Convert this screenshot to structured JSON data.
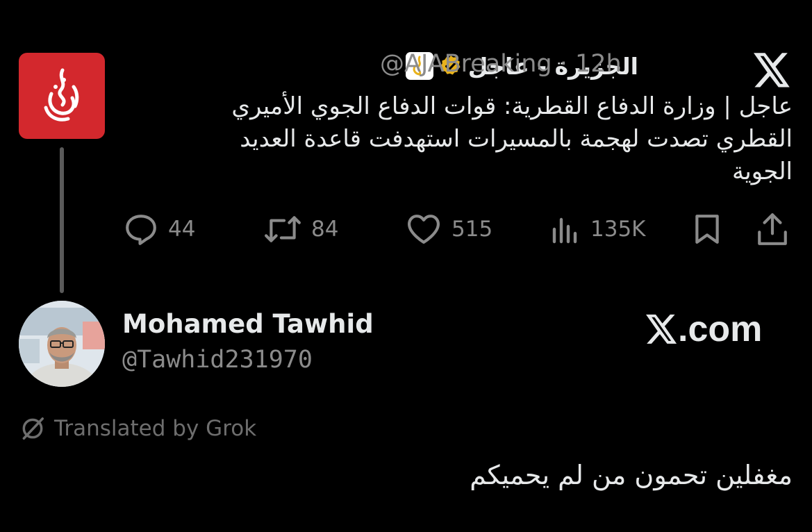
{
  "quoted_tweet": {
    "display_name": "الجزيرة - عاجل",
    "handle": "@AJABreaking",
    "time": "· 12h",
    "text_line1": "عاجل | وزارة الدفاع القطرية: قوات الدفاع الجوي الأميري",
    "text_line2": "القطري تصدت لهجمة بالمسيرات استهدفت قاعدة العديد",
    "text_line3": "الجوية",
    "avatar_icon": "al-jazeera-logo-icon",
    "badge_icon": "verified-gold-badge-icon",
    "colors": {
      "avatar_bg": "#d3282d",
      "badge": "#e8b21c",
      "muted": "#8b8b8b"
    },
    "actions": {
      "replies": "44",
      "reposts": "84",
      "likes": "515",
      "views": "135K"
    }
  },
  "author": {
    "name": "Mohamed Tawhid",
    "handle": "@Tawhid231970",
    "avatar_icon": "user-photo-avatar"
  },
  "watermark": {
    "text": ".com",
    "logo_icon": "x-logo-icon"
  },
  "translation": {
    "label": "Translated by Grok",
    "icon": "grok-icon"
  },
  "reply": {
    "text": "مغفلين تحمون من لم يحميكم"
  }
}
